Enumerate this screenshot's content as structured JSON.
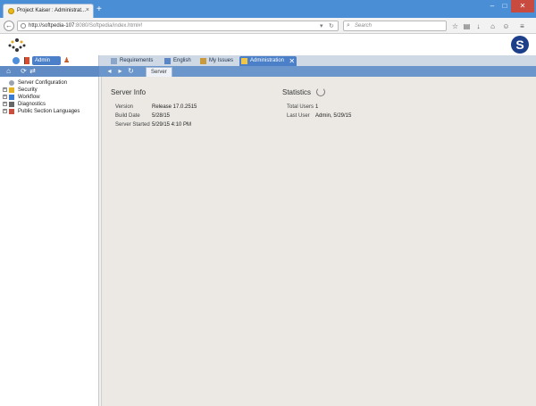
{
  "browser": {
    "tab_title": "Project Kaiser : Administrat...",
    "new_tab": "+",
    "url_host": "http://softpedia-107",
    "url_rest": ":8080/Softpedia/index.html#!",
    "search_placeholder": "Search"
  },
  "app": {
    "left_admin_label": "Admin",
    "tabs": [
      {
        "label": "Requirements"
      },
      {
        "label": "English"
      },
      {
        "label": "My Issues"
      },
      {
        "label": "Administration"
      }
    ],
    "subtab": "Server",
    "brand_letter": "S"
  },
  "tree": {
    "items": [
      {
        "label": "Server Configuration",
        "expandable": false
      },
      {
        "label": "Security",
        "expandable": true
      },
      {
        "label": "Workflow",
        "expandable": true
      },
      {
        "label": "Diagnostics",
        "expandable": true
      },
      {
        "label": "Public Section Languages",
        "expandable": true
      }
    ]
  },
  "server_info": {
    "title": "Server Info",
    "rows": [
      {
        "key": "Version",
        "value": "Release 17.0.2515"
      },
      {
        "key": "Build Date",
        "value": "5/28/15"
      },
      {
        "key": "Server Started",
        "value": "5/29/15 4:10 PM"
      }
    ]
  },
  "statistics": {
    "title": "Statistics",
    "rows": [
      {
        "key": "Total Users",
        "value": "1"
      },
      {
        "key": "Last User",
        "value": "Admin, 5/29/15"
      }
    ]
  },
  "colors": {
    "browser_titlebar": "#4a8fd6",
    "app_tab_active": "#4b80c8",
    "subbar": "#6b96cc",
    "content_bg": "#ece9e4"
  }
}
